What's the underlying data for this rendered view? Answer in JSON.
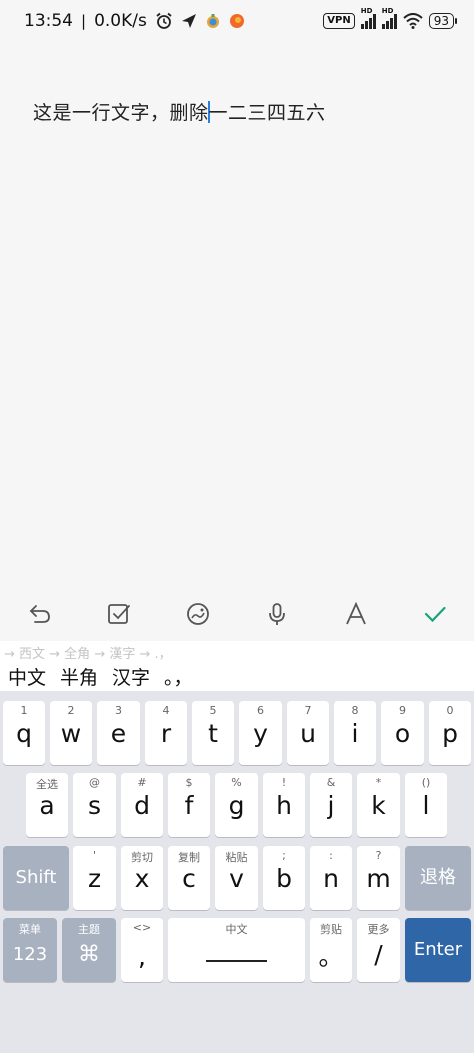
{
  "status_bar": {
    "time": "13:54",
    "separator": "|",
    "net_speed": "0.0K/s",
    "vpn": "VPN",
    "sig1_label": "HD",
    "sig2_label": "HD",
    "battery": "93"
  },
  "editor": {
    "text_before_caret": "这是一行文字，删除",
    "text_after_caret": "一二三四五六"
  },
  "toolbar": {
    "items": [
      "undo-icon",
      "checklist-icon",
      "sticker-icon",
      "microphone-icon",
      "text-format-icon",
      "checkmark-icon"
    ],
    "accent": "#1aa37a"
  },
  "ime": {
    "hint": "→ 西文 → 全角 → 漢字 → .，",
    "candidates": [
      "中文",
      "半角",
      "汉字",
      "。，"
    ]
  },
  "keyboard": {
    "row1": [
      {
        "sub": "1",
        "main": "q"
      },
      {
        "sub": "2",
        "main": "w"
      },
      {
        "sub": "3",
        "main": "e"
      },
      {
        "sub": "4",
        "main": "r"
      },
      {
        "sub": "5",
        "main": "t"
      },
      {
        "sub": "6",
        "main": "y"
      },
      {
        "sub": "7",
        "main": "u"
      },
      {
        "sub": "8",
        "main": "i"
      },
      {
        "sub": "9",
        "main": "o"
      },
      {
        "sub": "0",
        "main": "p"
      }
    ],
    "row2": [
      {
        "sub": "全选",
        "main": "a"
      },
      {
        "sub": "@",
        "main": "s"
      },
      {
        "sub": "#",
        "main": "d"
      },
      {
        "sub": "$",
        "main": "f"
      },
      {
        "sub": "%",
        "main": "g"
      },
      {
        "sub": "!",
        "main": "h"
      },
      {
        "sub": "&",
        "main": "j"
      },
      {
        "sub": "*",
        "main": "k"
      },
      {
        "sub": "()",
        "main": "l"
      }
    ],
    "row3": {
      "shift": "Shift",
      "keys": [
        {
          "sub": "'",
          "main": "z"
        },
        {
          "sub": "剪切",
          "main": "x"
        },
        {
          "sub": "复制",
          "main": "c"
        },
        {
          "sub": "粘贴",
          "main": "v"
        },
        {
          "sub": ";",
          "main": "b"
        },
        {
          "sub": ":",
          "main": "n"
        },
        {
          "sub": "?",
          "main": "m"
        }
      ],
      "backspace": "退格"
    },
    "row4": {
      "menu_sub": "菜单",
      "menu_main": "123",
      "theme_sub": "主题",
      "theme_main": "⌘",
      "comma_sub": "<>",
      "comma_main": ",",
      "space_sub": "中文",
      "period_sub": "剪贴",
      "period_main": "。",
      "slash_sub": "更多",
      "slash_main": "/",
      "enter": "Enter"
    }
  }
}
